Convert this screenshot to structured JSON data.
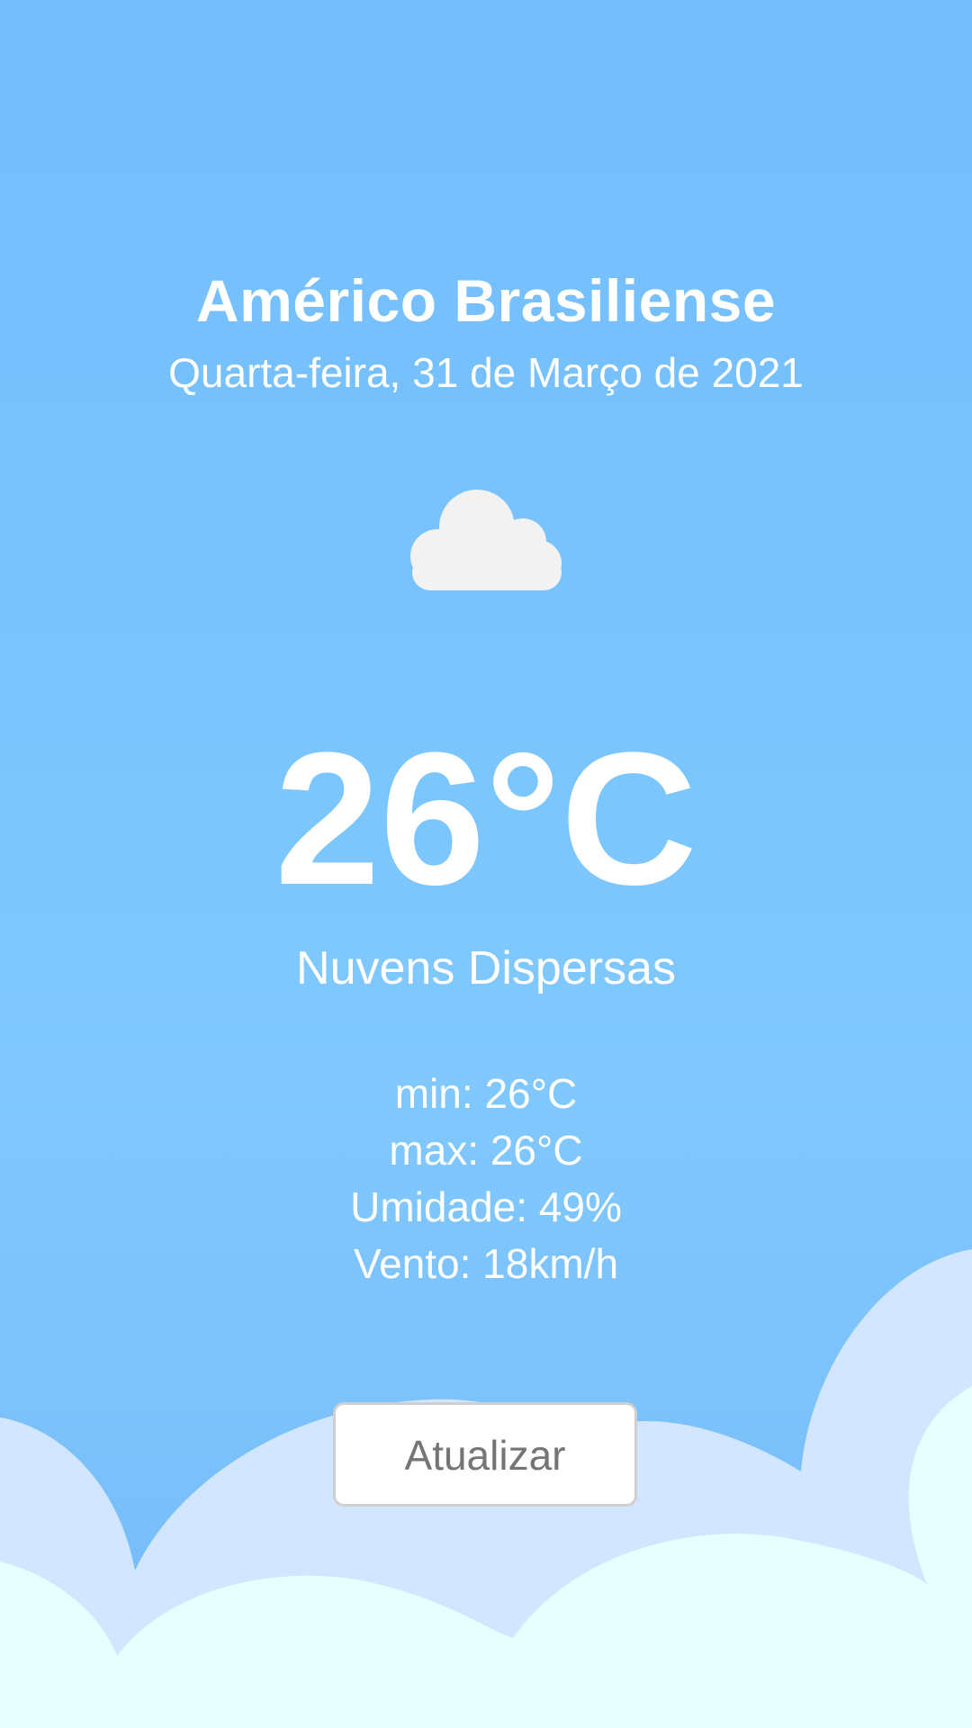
{
  "location": {
    "city": "Américo Brasiliense",
    "date": "Quarta-feira, 31 de Março de 2021"
  },
  "current": {
    "icon": "cloud-icon",
    "temperature": "26°C",
    "description": "Nuvens Dispersas"
  },
  "details": {
    "min": "min: 26°C",
    "max": "max: 26°C",
    "humidity": "Umidade: 49%",
    "wind": "Vento: 18km/h"
  },
  "actions": {
    "refresh_label": "Atualizar"
  },
  "colors": {
    "sky": "#78c3fd",
    "cloud_light": "#d2e6ff",
    "cloud_bottom": "#e8ffff",
    "button_text": "#757575",
    "icon_cloud": "#f2f2f2"
  }
}
